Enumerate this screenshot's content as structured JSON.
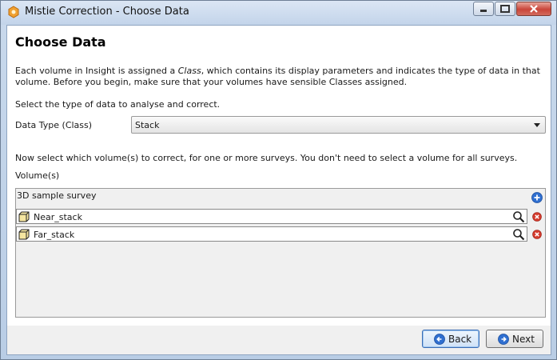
{
  "window": {
    "title": "Mistie Correction - Choose Data"
  },
  "page": {
    "heading": "Choose Data",
    "intro_before": "Each volume in Insight is assigned a ",
    "intro_class": "Class",
    "intro_after": ", which contains its display parameters and indicates the type of data in that volume. Before you begin, make sure that your volumes have sensible Classes assigned.",
    "select_prompt": "Select the type of data to analyse and correct.",
    "data_type_label": "Data Type (Class)",
    "data_type_value": "Stack",
    "volume_prompt": "Now select which volume(s) to correct, for one or more surveys. You don't need to select a volume for all surveys.",
    "volumes_label": "Volume(s)"
  },
  "survey": {
    "name": "3D sample survey",
    "volumes": [
      {
        "name": "Near_stack"
      },
      {
        "name": "Far_stack"
      }
    ]
  },
  "buttons": {
    "back": "Back",
    "next": "Next"
  },
  "colors": {
    "accent": "#2f6fd0",
    "remove": "#d33a2c"
  }
}
